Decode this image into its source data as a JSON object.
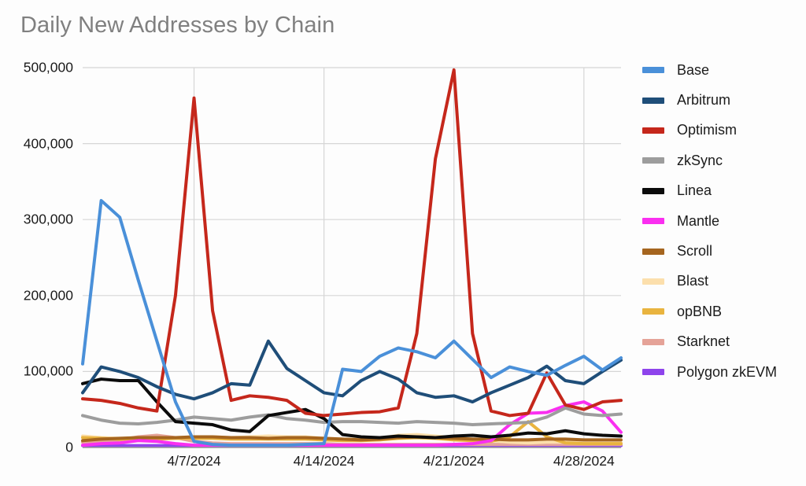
{
  "chart": {
    "title": "Daily New Addresses by Chain"
  },
  "axes": {
    "y_ticks": [
      "0",
      "100,000",
      "200,000",
      "300,000",
      "400,000",
      "500,000"
    ],
    "x_ticks": [
      "4/7/2024",
      "4/14/2024",
      "4/21/2024",
      "4/28/2024"
    ]
  },
  "legend": {
    "items": [
      {
        "label": "Base",
        "color": "#4a90d9"
      },
      {
        "label": "Arbitrum",
        "color": "#1f4e79"
      },
      {
        "label": "Optimism",
        "color": "#c5271b"
      },
      {
        "label": "zkSync",
        "color": "#9d9d9d"
      },
      {
        "label": "Linea",
        "color": "#0b0b0b"
      },
      {
        "label": "Mantle",
        "color": "#fa2ff0"
      },
      {
        "label": "Scroll",
        "color": "#a5651f"
      },
      {
        "label": "Blast",
        "color": "#fcdfac"
      },
      {
        "label": "opBNB",
        "color": "#e9b43f"
      },
      {
        "label": "Starknet",
        "color": "#e5a398"
      },
      {
        "label": "Polygon zkEVM",
        "color": "#8e44ec"
      }
    ]
  },
  "chart_data": {
    "type": "line",
    "title": "Daily New Addresses by Chain",
    "xlabel": "",
    "ylabel": "",
    "ylim": [
      0,
      500000
    ],
    "ytick_values": [
      0,
      100000,
      200000,
      300000,
      400000,
      500000
    ],
    "grid": true,
    "legend_position": "right",
    "x": [
      "4/1/2024",
      "4/2/2024",
      "4/3/2024",
      "4/4/2024",
      "4/5/2024",
      "4/6/2024",
      "4/7/2024",
      "4/8/2024",
      "4/9/2024",
      "4/10/2024",
      "4/11/2024",
      "4/12/2024",
      "4/13/2024",
      "4/14/2024",
      "4/15/2024",
      "4/16/2024",
      "4/17/2024",
      "4/18/2024",
      "4/19/2024",
      "4/20/2024",
      "4/21/2024",
      "4/22/2024",
      "4/23/2024",
      "4/24/2024",
      "4/25/2024",
      "4/26/2024",
      "4/27/2024",
      "4/28/2024",
      "4/29/2024",
      "4/30/2024"
    ],
    "xtick_indices": [
      6,
      13,
      20,
      27
    ],
    "xtick_labels": [
      "4/7/2024",
      "4/14/2024",
      "4/21/2024",
      "4/28/2024"
    ],
    "series": [
      {
        "name": "Base",
        "color": "#4a90d9",
        "values": [
          110000,
          325000,
          303000,
          220000,
          140000,
          60000,
          8000,
          4000,
          3000,
          3000,
          3000,
          3000,
          4000,
          5000,
          103000,
          100000,
          120000,
          131000,
          126000,
          118000,
          140000,
          116000,
          92000,
          106000,
          100000,
          95000,
          108000,
          120000,
          102000,
          118000
        ]
      },
      {
        "name": "Arbitrum",
        "color": "#1f4e79",
        "values": [
          72000,
          106000,
          100000,
          92000,
          80000,
          70000,
          64000,
          72000,
          84000,
          82000,
          140000,
          104000,
          88000,
          72000,
          68000,
          88000,
          100000,
          90000,
          72000,
          66000,
          68000,
          60000,
          72000,
          82000,
          92000,
          107000,
          88000,
          84000,
          100000,
          115000
        ]
      },
      {
        "name": "Optimism",
        "color": "#c5271b",
        "values": [
          64000,
          62000,
          58000,
          52000,
          48000,
          200000,
          460000,
          180000,
          62000,
          68000,
          66000,
          62000,
          45000,
          42000,
          44000,
          46000,
          47000,
          52000,
          150000,
          380000,
          497000,
          150000,
          48000,
          42000,
          45000,
          98000,
          56000,
          50000,
          60000,
          62000
        ]
      },
      {
        "name": "zkSync",
        "color": "#9d9d9d",
        "values": [
          42000,
          36000,
          32000,
          31000,
          33000,
          36000,
          40000,
          38000,
          36000,
          40000,
          43000,
          38000,
          36000,
          33000,
          34000,
          34000,
          33000,
          32000,
          34000,
          33000,
          32000,
          30000,
          31000,
          32000,
          33000,
          40000,
          52000,
          44000,
          42000,
          44000
        ]
      },
      {
        "name": "Linea",
        "color": "#0b0b0b",
        "values": [
          84000,
          90000,
          88000,
          88000,
          60000,
          34000,
          32000,
          30000,
          23000,
          21000,
          42000,
          46000,
          50000,
          38000,
          17000,
          14000,
          13000,
          15000,
          14000,
          13000,
          15000,
          16000,
          14000,
          16000,
          19000,
          18000,
          22000,
          18000,
          16000,
          15000
        ]
      },
      {
        "name": "Mantle",
        "color": "#fa2ff0",
        "values": [
          3000,
          5000,
          6000,
          9000,
          8000,
          5000,
          3000,
          3000,
          3000,
          3000,
          3000,
          3000,
          3000,
          3000,
          3000,
          3000,
          3000,
          3000,
          3000,
          3000,
          4000,
          5000,
          9000,
          30000,
          45000,
          46000,
          55000,
          60000,
          48000,
          20000
        ]
      },
      {
        "name": "Scroll",
        "color": "#a5651f",
        "values": [
          9000,
          11000,
          12000,
          13000,
          13000,
          13000,
          14000,
          14000,
          13000,
          13000,
          12000,
          13000,
          13000,
          12000,
          11000,
          10000,
          11000,
          13000,
          14000,
          13000,
          12000,
          11000,
          11000,
          10000,
          10000,
          11000,
          11000,
          10000,
          10000,
          10000
        ]
      },
      {
        "name": "Blast",
        "color": "#fcdfac",
        "values": [
          15000,
          13000,
          12000,
          12000,
          12000,
          13000,
          14000,
          14000,
          13000,
          14000,
          15000,
          14000,
          14000,
          12000,
          11000,
          11000,
          12000,
          16000,
          17000,
          15000,
          13000,
          11000,
          9000,
          7000,
          6000,
          7000,
          7000,
          7000,
          6000,
          6000
        ]
      },
      {
        "name": "opBNB",
        "color": "#e9b43f",
        "values": [
          13000,
          12000,
          11000,
          11000,
          11000,
          12000,
          12000,
          12000,
          11000,
          11000,
          11000,
          11000,
          11000,
          10000,
          9000,
          9000,
          10000,
          12000,
          13000,
          12000,
          10000,
          9000,
          8000,
          14000,
          34000,
          14000,
          6000,
          5000,
          5000,
          5000
        ]
      },
      {
        "name": "Starknet",
        "color": "#e5a398",
        "values": [
          7000,
          8000,
          10000,
          14000,
          16000,
          13000,
          8000,
          6000,
          5000,
          5000,
          5000,
          5000,
          5000,
          5000,
          4000,
          4000,
          4000,
          4000,
          4000,
          4000,
          4000,
          4000,
          4000,
          4000,
          4000,
          4000,
          4000,
          4000,
          4000,
          4000
        ]
      },
      {
        "name": "Polygon zkEVM",
        "color": "#8e44ec",
        "values": [
          2500,
          2500,
          2500,
          2500,
          2500,
          2500,
          2500,
          2500,
          2500,
          2500,
          2500,
          2500,
          2500,
          2500,
          2500,
          2500,
          2500,
          2500,
          2500,
          2500,
          2500,
          2500,
          2500,
          2500,
          2500,
          2500,
          2500,
          2500,
          2500,
          2500
        ]
      }
    ]
  }
}
